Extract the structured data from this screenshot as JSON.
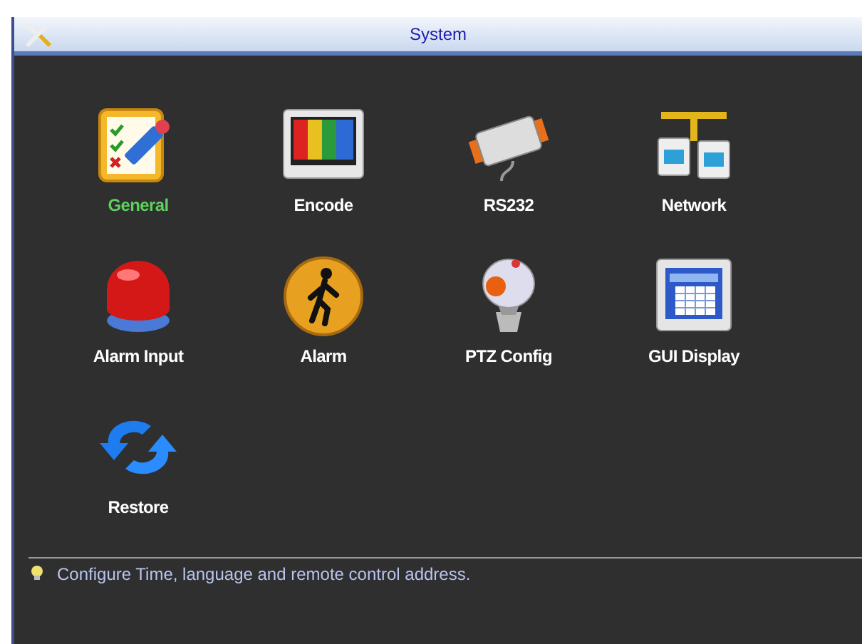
{
  "window": {
    "title": "System"
  },
  "items": [
    {
      "label": "General",
      "kind": "general",
      "selected": true
    },
    {
      "label": "Encode",
      "kind": "encode",
      "selected": false
    },
    {
      "label": "RS232",
      "kind": "rs232",
      "selected": false
    },
    {
      "label": "Network",
      "kind": "network",
      "selected": false
    },
    {
      "label": "Alarm Input",
      "kind": "alarm_input",
      "selected": false
    },
    {
      "label": "Alarm",
      "kind": "alarm",
      "selected": false
    },
    {
      "label": "PTZ Config",
      "kind": "ptz",
      "selected": false
    },
    {
      "label": "GUI Display",
      "kind": "gui",
      "selected": false
    },
    {
      "label": "Restore",
      "kind": "restore",
      "selected": false
    }
  ],
  "hint": "Configure Time, language and remote control address."
}
